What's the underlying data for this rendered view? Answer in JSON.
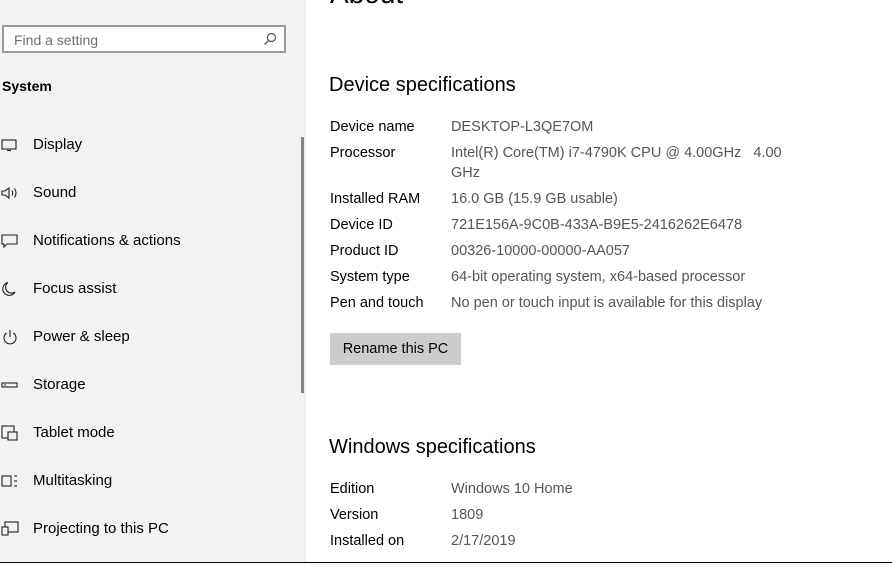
{
  "search": {
    "placeholder": "Find a setting"
  },
  "sidebar": {
    "title": "System",
    "items": [
      {
        "label": "Display",
        "icon": "display-icon"
      },
      {
        "label": "Sound",
        "icon": "sound-icon"
      },
      {
        "label": "Notifications & actions",
        "icon": "notifications-icon"
      },
      {
        "label": "Focus assist",
        "icon": "moon-icon"
      },
      {
        "label": "Power & sleep",
        "icon": "power-icon"
      },
      {
        "label": "Storage",
        "icon": "storage-icon"
      },
      {
        "label": "Tablet mode",
        "icon": "tablet-mode-icon"
      },
      {
        "label": "Multitasking",
        "icon": "multitasking-icon"
      },
      {
        "label": "Projecting to this PC",
        "icon": "projecting-icon"
      }
    ]
  },
  "main": {
    "title": "About",
    "device_specs": {
      "title": "Device specifications",
      "rows": [
        {
          "label": "Device name",
          "value": "DESKTOP-L3QE7OM"
        },
        {
          "label": "Processor",
          "value": "Intel(R) Core(TM) i7-4790K CPU @ 4.00GHz   4.00",
          "value2": "GHz"
        },
        {
          "label": "Installed RAM",
          "value": "16.0 GB (15.9 GB usable)"
        },
        {
          "label": "Device ID",
          "value": "721E156A-9C0B-433A-B9E5-2416262E6478"
        },
        {
          "label": "Product ID",
          "value": "00326-10000-00000-AA057"
        },
        {
          "label": "System type",
          "value": "64-bit operating system, x64-based processor"
        },
        {
          "label": "Pen and touch",
          "value": "No pen or touch input is available for this display"
        }
      ],
      "rename_label": "Rename this PC"
    },
    "windows_specs": {
      "title": "Windows specifications",
      "rows": [
        {
          "label": "Edition",
          "value": "Windows 10 Home"
        },
        {
          "label": "Version",
          "value": "1809"
        },
        {
          "label": "Installed on",
          "value": "2/17/2019"
        }
      ]
    }
  },
  "colors": {
    "sidebar_bg": "#f2f2f2",
    "button_bg": "#cccccc",
    "value_text": "#555555"
  }
}
